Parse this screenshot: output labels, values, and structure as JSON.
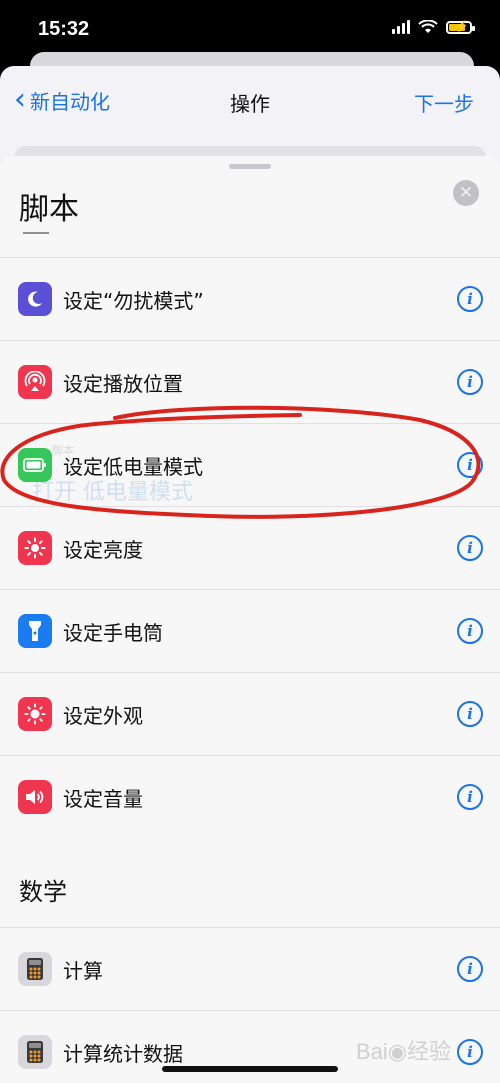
{
  "status_bar": {
    "time": "15:32"
  },
  "nav": {
    "back_label": "新自动化",
    "title": "操作",
    "next_label": "下一步"
  },
  "sheet": {
    "section_scripts": "脚本",
    "scripting_items": [
      {
        "label": "设定“勿扰模式”",
        "icon": "moon-icon",
        "color": "#5b4fd6"
      },
      {
        "label": "设定播放位置",
        "icon": "airplay-icon",
        "color": "#f0354f"
      },
      {
        "label": "设定低电量模式",
        "icon": "battery-icon",
        "color": "#35c759"
      },
      {
        "label": "设定亮度",
        "icon": "brightness-icon",
        "color": "#f0354f"
      },
      {
        "label": "设定手电筒",
        "icon": "flashlight-icon",
        "color": "#1a7cf0"
      },
      {
        "label": "设定外观",
        "icon": "appearance-icon",
        "color": "#f0354f"
      },
      {
        "label": "设定音量",
        "icon": "speaker-icon",
        "color": "#f0354f"
      }
    ],
    "section_math": "数学",
    "math_items": [
      {
        "label": "计算",
        "icon": "calculator-icon",
        "color": "#d8d8dc"
      },
      {
        "label": "计算统计数据",
        "icon": "calculator-icon",
        "color": "#d8d8dc"
      }
    ],
    "ghost_text": "打开  低电量模式",
    "ghost_small": "脚本"
  },
  "watermark": "Bai◉经验",
  "annotation_color": "#d8241c"
}
